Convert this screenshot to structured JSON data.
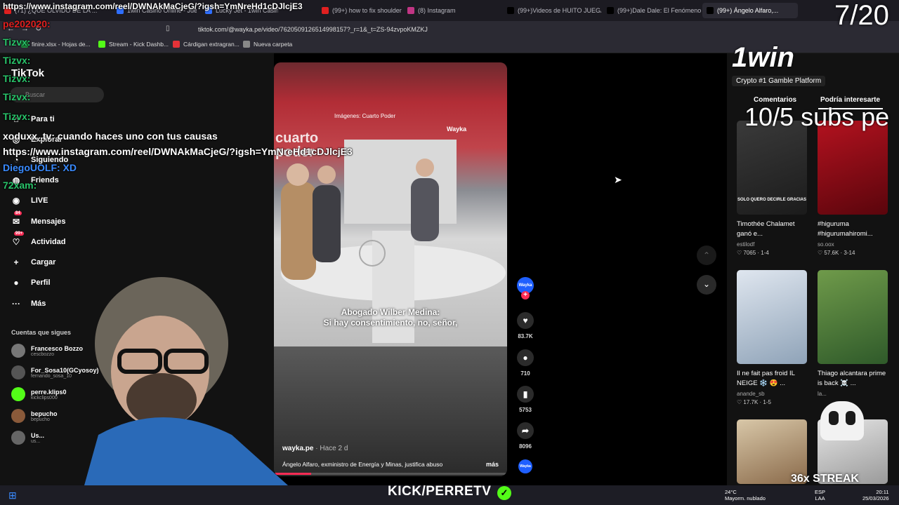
{
  "browser": {
    "tabs": [
      {
        "label": "(71) ¿QUE OLVIDO DE LA ...",
        "color": "#e02020"
      },
      {
        "label": "1win Casino Online - Juega y ...",
        "color": "#2f6fff"
      },
      {
        "label": "Lucky Jet - 1win Casino...",
        "color": "#2f6fff"
      },
      {
        "label": "(99+) how to fix shoulder Mobility ...",
        "color": "#e02020"
      },
      {
        "label": "(8) Instagram",
        "color": "#c13584"
      },
      {
        "label": "(99+)Videos de HUITO JUEGA ...",
        "color": "#000"
      },
      {
        "label": "(99+)Dale Dale: El Fenómeno...",
        "color": "#000"
      },
      {
        "label": "(99+) Ángelo Alfaro,...",
        "color": "#000"
      }
    ],
    "url": "tiktok.com/@wayka.pe/video/7620509126514998157?_r=1&_t=ZS-94zvpoKMZKJ",
    "bookmarks": [
      {
        "label": "finire.xlsx - Hojas de...",
        "color": "#1e8e3e"
      },
      {
        "label": "Stream - Kick Dashb...",
        "color": "#53fc18"
      },
      {
        "label": "Cárdigan extragran...",
        "color": "#e53238"
      },
      {
        "label": "Nueva carpeta",
        "color": "#888"
      }
    ]
  },
  "sidebar": {
    "logo": "TikTok",
    "search_placeholder": "Buscar",
    "nav": [
      {
        "label": "Para ti",
        "icon": "home-icon",
        "glyph": "⌂"
      },
      {
        "label": "Explorar",
        "icon": "compass-icon",
        "glyph": "◎"
      },
      {
        "label": "Siguiendo",
        "icon": "following-icon",
        "glyph": "◔"
      },
      {
        "label": "Friends",
        "icon": "friends-icon",
        "glyph": "◍"
      },
      {
        "label": "LIVE",
        "icon": "live-icon",
        "glyph": "◉"
      },
      {
        "label": "Mensajes",
        "icon": "messages-icon",
        "glyph": "✉",
        "badge": "84"
      },
      {
        "label": "Actividad",
        "icon": "activity-icon",
        "glyph": "♡",
        "badge": "99+"
      },
      {
        "label": "Cargar",
        "icon": "upload-icon",
        "glyph": "+"
      },
      {
        "label": "Perfil",
        "icon": "profile-icon",
        "glyph": "●"
      },
      {
        "label": "Más",
        "icon": "more-icon",
        "glyph": "···"
      }
    ],
    "following_title": "Cuentas que sigues",
    "following": [
      {
        "name": "Francesco Bozzo",
        "handle": "cescbozzo",
        "color": "#777"
      },
      {
        "name": "For_Sosa10(GCyosoy)",
        "handle": "fernando_sosa_10",
        "color": "#555"
      },
      {
        "name": "perre.klips0",
        "handle": "kickclips000",
        "color": "#53fc18"
      },
      {
        "name": "bepucho",
        "handle": "bepucho",
        "color": "#8a5a3a"
      },
      {
        "name": "Us...",
        "handle": "us...",
        "color": "#666"
      }
    ]
  },
  "video": {
    "image_credit": "Imágenes: Cuarto Poder",
    "watermark": "Wayka",
    "brand_text": "cuarto poder",
    "subtitle_line1": "Abogado Wilber Medina:",
    "subtitle_line2": "Si hay consentimiento, no, señor,",
    "author": "wayka.pe",
    "time_ago": "· Hace 2 d",
    "description": "Ángelo Alfaro, exministro de Energía y Minas, justifica abuso",
    "more_label": "más"
  },
  "actions": {
    "avatar_label": "Wayka",
    "likes": "83.7K",
    "comments": "710",
    "saves": "5753",
    "shares": "8096",
    "music_label": "Wayka"
  },
  "right_pane": {
    "tab_comments": "Comentarios",
    "tab_suggested": "Podría interesarte",
    "cards": [
      {
        "title": "Timothée Chalamet ganó e...",
        "author": "estilodf",
        "stats": "♡ 7065 · 1-4",
        "color1": "#3a3a3a",
        "color2": "#1b1b1b",
        "overlay": "SOLO QUERO DECIRLE GRACIAS"
      },
      {
        "title": "#higuruma #higurumahiromi...",
        "author": "so.oox",
        "stats": "♡ 57.6K · 3-14",
        "color1": "#b3121f",
        "color2": "#5a050c",
        "overlay": ""
      },
      {
        "title": "Il ne fait pas froid IL NEIGE ❄️ 😍 ...",
        "author": "anande_sb",
        "stats": "♡ 17.7K · 1-5",
        "color1": "#dfe6ef",
        "color2": "#8fa3b8",
        "overlay": ""
      },
      {
        "title": "Thiago alcantara prime is back ☠️ ...",
        "author": "la...",
        "stats": "",
        "color1": "#6f9a4a",
        "color2": "#2f5a2a",
        "overlay": ""
      },
      {
        "title": "",
        "author": "",
        "stats": "",
        "color1": "#d8c7a8",
        "color2": "#8a6a4a",
        "overlay": ""
      },
      {
        "title": "",
        "author": "",
        "stats": "",
        "color1": "#e5e5e5",
        "color2": "#9a9a9a",
        "overlay": ""
      }
    ]
  },
  "chat": {
    "lines": [
      {
        "text": "pe202020:",
        "color": "#e02020"
      },
      {
        "text": "Tizvx:",
        "color": "#29c46a"
      },
      {
        "text": "Tizvx:",
        "color": "#29c46a"
      },
      {
        "text": "Tizvx:",
        "color": "#29c46a"
      },
      {
        "text": "Tizvx:",
        "color": "#29c46a"
      },
      {
        "text": "Tizvx:",
        "color": "#29c46a"
      },
      {
        "text": "xoduxx_tv: cuando haces uno con tus causas",
        "color": "#ffffff"
      },
      {
        "text": "https://www.instagram.com/reel/DWNAkMaCjeG/?igsh=YmNreHd1cDJlcjE3",
        "color": "#ffffff"
      },
      {
        "text": "DiegoUOLF: XD",
        "color": "#3a8bff"
      },
      {
        "text": "72xam:",
        "color": "#29c46a"
      }
    ],
    "top_link": "https://www.instagram.com/reel/DWNAkMaCjeG/?igsh=YmNreHd1cDJlcjE3"
  },
  "overlays": {
    "counter": "7/20",
    "brand": "1win",
    "brand_tagline": "Crypto #1 Gamble Platform",
    "subs_text": "10/5 subs pe",
    "streak": "36x STREAK",
    "kick_label": "KICK/PERRETV"
  },
  "taskbar": {
    "weather_temp": "24°C",
    "weather_desc": "Mayorm. nublado",
    "lang1": "ESP",
    "lang2": "LAA",
    "time": "20:11",
    "date": "25/03/2026"
  }
}
